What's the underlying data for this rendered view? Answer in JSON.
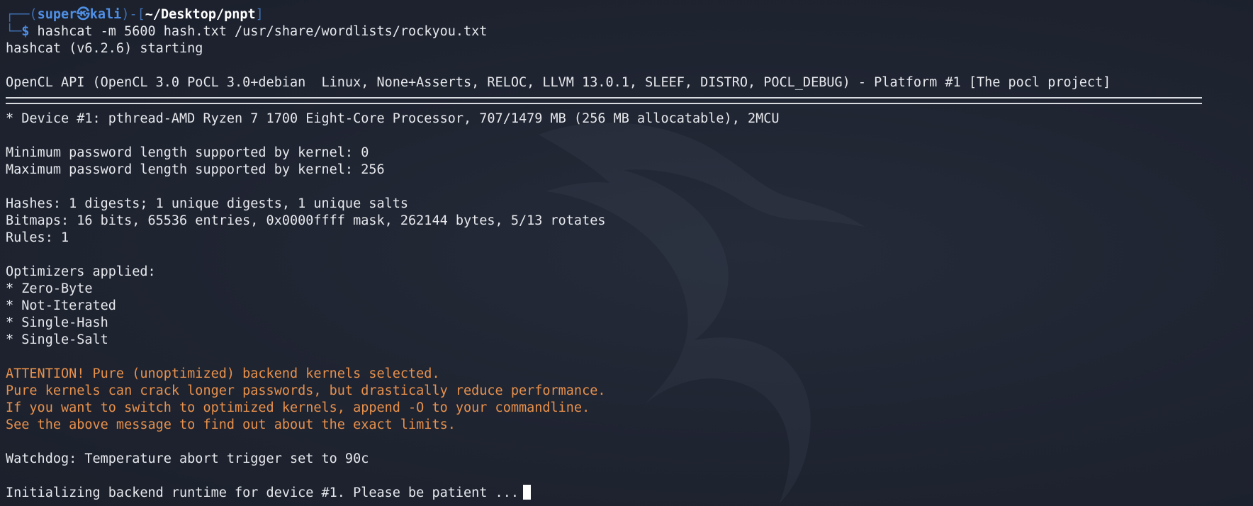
{
  "prompt": {
    "box_top": "┌──(",
    "user": "super㉿kali",
    "separator": ")-[",
    "path": "~/Desktop/pnpt",
    "close": "]",
    "box_bottom": "└─",
    "dollar": "$",
    "command": " hashcat -m 5600 hash.txt /usr/share/wordlists/rockyou.txt"
  },
  "output": {
    "starting": "hashcat (v6.2.6) starting",
    "opencl": "OpenCL API (OpenCL 3.0 PoCL 3.0+debian  Linux, None+Asserts, RELOC, LLVM 13.0.1, SLEEF, DISTRO, POCL_DEBUG) - Platform #1 [The pocl project]",
    "device": "* Device #1: pthread-AMD Ryzen 7 1700 Eight-Core Processor, 707/1479 MB (256 MB allocatable), 2MCU",
    "min_pw": "Minimum password length supported by kernel: 0",
    "max_pw": "Maximum password length supported by kernel: 256",
    "hashes": "Hashes: 1 digests; 1 unique digests, 1 unique salts",
    "bitmaps": "Bitmaps: 16 bits, 65536 entries, 0x0000ffff mask, 262144 bytes, 5/13 rotates",
    "rules": "Rules: 1",
    "optimizers_header": "Optimizers applied:",
    "optimizers": [
      "* Zero-Byte",
      "* Not-Iterated",
      "* Single-Hash",
      "* Single-Salt"
    ],
    "attention": [
      "ATTENTION! Pure (unoptimized) backend kernels selected.",
      "Pure kernels can crack longer passwords, but drastically reduce performance.",
      "If you want to switch to optimized kernels, append -O to your commandline.",
      "See the above message to find out about the exact limits."
    ],
    "watchdog": "Watchdog: Temperature abort trigger set to 90c",
    "initializing": "Initializing backend runtime for device #1. Please be patient ..."
  },
  "colors": {
    "background": "#1f2431",
    "text": "#e6e8ec",
    "prompt_blue": "#4f8fe6",
    "warning_orange": "#e8914c"
  },
  "icons": {
    "watermark": "kali-dragon-icon"
  }
}
